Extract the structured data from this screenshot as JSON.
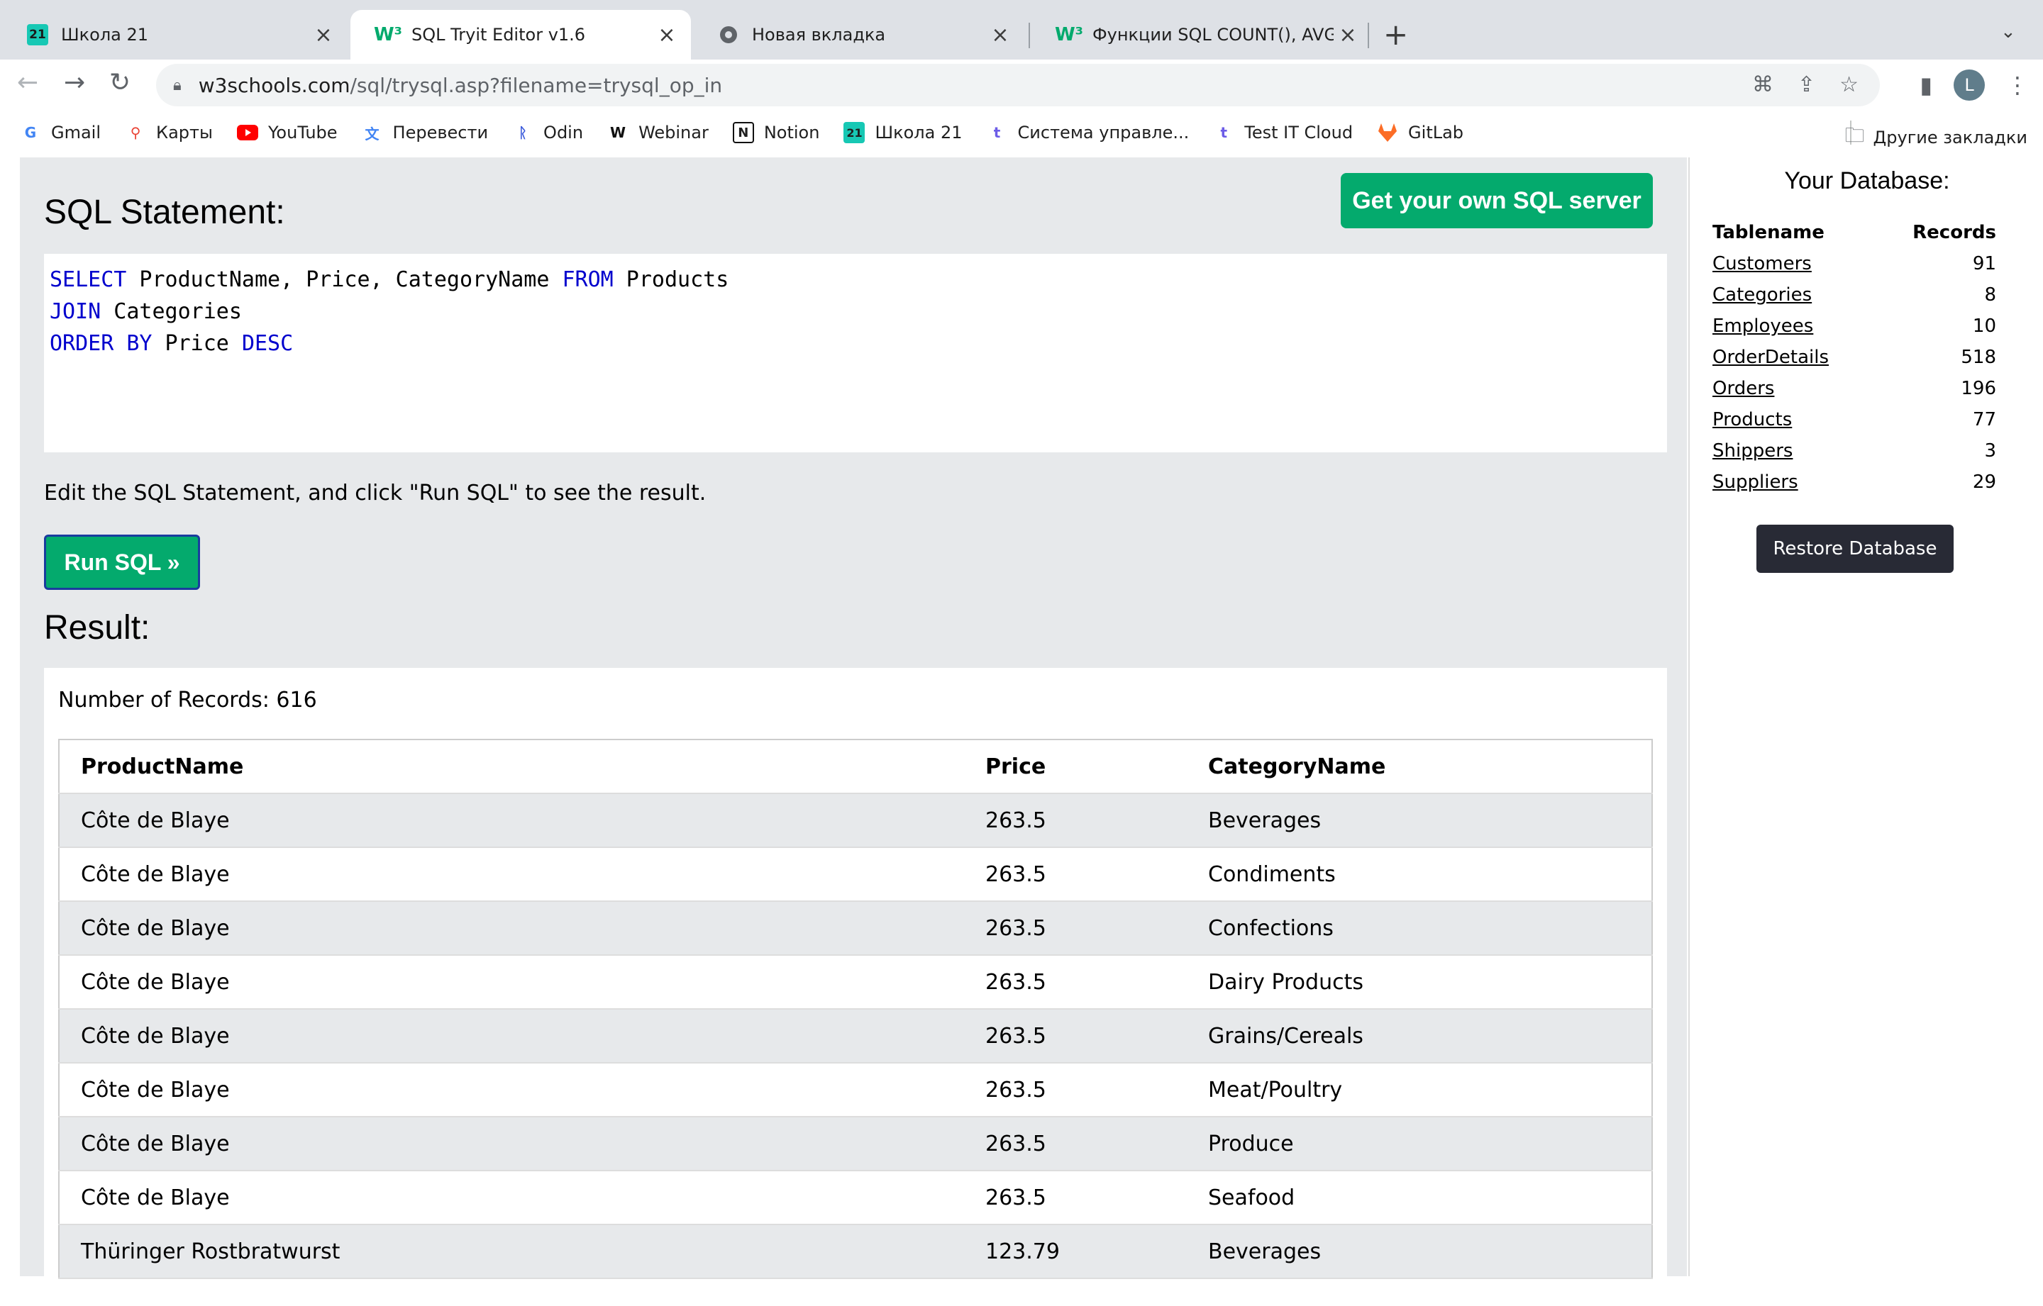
{
  "tabs": [
    {
      "title": "Школа 21",
      "icon": "school21-icon",
      "active": false
    },
    {
      "title": "SQL Tryit Editor v1.6",
      "icon": "w3schools-icon",
      "active": true
    },
    {
      "title": "Новая вкладка",
      "icon": "chrome-icon",
      "active": false
    },
    {
      "title": "Функции SQL COUNT(), AVG()",
      "icon": "w3schools-icon",
      "active": false
    }
  ],
  "address": {
    "host": "w3schools.com",
    "path": "/sql/trysql.asp?filename=trysql_op_in"
  },
  "profile_initial": "L",
  "bookmarks": [
    {
      "label": "Gmail",
      "icon": "google-icon"
    },
    {
      "label": "Карты",
      "icon": "maps-icon"
    },
    {
      "label": "YouTube",
      "icon": "youtube-icon"
    },
    {
      "label": "Перевести",
      "icon": "translate-icon"
    },
    {
      "label": "Odin",
      "icon": "odin-icon"
    },
    {
      "label": "Webinar",
      "icon": "webinar-icon"
    },
    {
      "label": "Notion",
      "icon": "notion-icon"
    },
    {
      "label": "Школа 21",
      "icon": "school21-icon"
    },
    {
      "label": "Система управле...",
      "icon": "testit-icon"
    },
    {
      "label": "Test IT Cloud",
      "icon": "testit-icon"
    },
    {
      "label": "GitLab",
      "icon": "gitlab-icon"
    }
  ],
  "other_bookmarks": "Другие закладки",
  "editor": {
    "heading": "SQL Statement:",
    "get_server": "Get your own SQL server",
    "lines": [
      [
        {
          "t": "SELECT",
          "k": true
        },
        {
          "t": " ProductName, Price, CategoryName ",
          "k": false
        },
        {
          "t": "FROM",
          "k": true
        },
        {
          "t": " Products",
          "k": false
        }
      ],
      [
        {
          "t": "JOIN",
          "k": true
        },
        {
          "t": " Categories",
          "k": false
        }
      ],
      [
        {
          "t": "ORDER BY",
          "k": true
        },
        {
          "t": " Price ",
          "k": false
        },
        {
          "t": "DESC",
          "k": true
        }
      ]
    ],
    "hint": "Edit the SQL Statement, and click \"Run SQL\" to see the result.",
    "run_label": "Run SQL »"
  },
  "result": {
    "heading": "Result:",
    "count_text": "Number of Records: 616",
    "columns": [
      "ProductName",
      "Price",
      "CategoryName"
    ],
    "rows": [
      [
        "Côte de Blaye",
        "263.5",
        "Beverages"
      ],
      [
        "Côte de Blaye",
        "263.5",
        "Condiments"
      ],
      [
        "Côte de Blaye",
        "263.5",
        "Confections"
      ],
      [
        "Côte de Blaye",
        "263.5",
        "Dairy Products"
      ],
      [
        "Côte de Blaye",
        "263.5",
        "Grains/Cereals"
      ],
      [
        "Côte de Blaye",
        "263.5",
        "Meat/Poultry"
      ],
      [
        "Côte de Blaye",
        "263.5",
        "Produce"
      ],
      [
        "Côte de Blaye",
        "263.5",
        "Seafood"
      ],
      [
        "Thüringer Rostbratwurst",
        "123.79",
        "Beverages"
      ]
    ]
  },
  "database": {
    "title": "Your Database:",
    "col_name": "Tablename",
    "col_records": "Records",
    "tables": [
      {
        "name": "Customers",
        "records": "91"
      },
      {
        "name": "Categories",
        "records": "8"
      },
      {
        "name": "Employees",
        "records": "10"
      },
      {
        "name": "OrderDetails",
        "records": "518"
      },
      {
        "name": "Orders",
        "records": "196"
      },
      {
        "name": "Products",
        "records": "77"
      },
      {
        "name": "Shippers",
        "records": "3"
      },
      {
        "name": "Suppliers",
        "records": "29"
      }
    ],
    "restore_label": "Restore Database"
  },
  "colors": {
    "w3_green": "#04aa6d",
    "keyword_blue": "#0000cd",
    "pane_grey": "#e7e9eb",
    "restore_dark": "#282a35"
  }
}
